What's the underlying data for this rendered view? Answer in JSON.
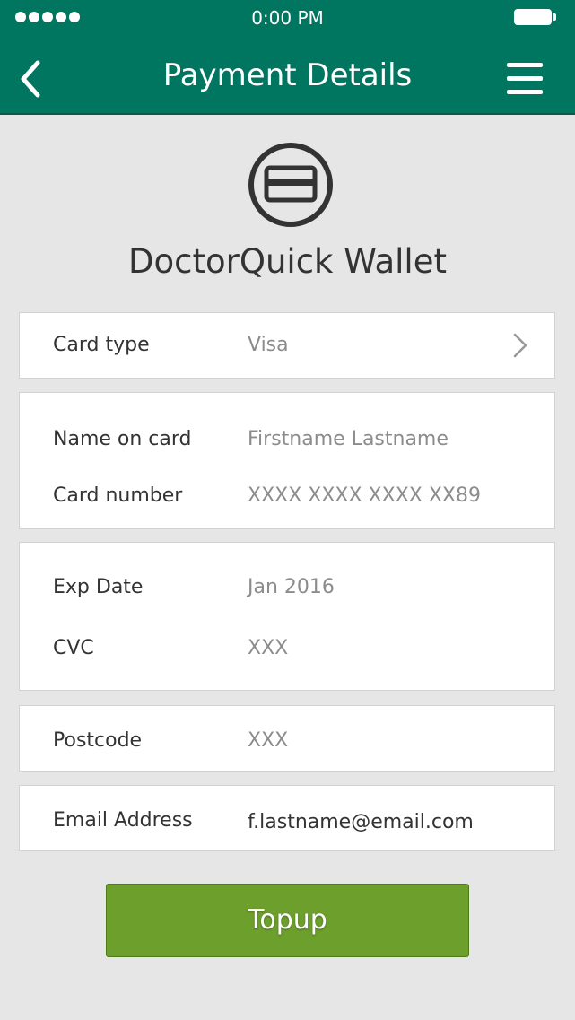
{
  "status_bar": {
    "time": "0:00 PM"
  },
  "nav": {
    "title": "Payment Details"
  },
  "wallet": {
    "title": "DoctorQuick Wallet"
  },
  "card_type": {
    "label": "Card type",
    "value": "Visa"
  },
  "name_on_card": {
    "label": "Name on card",
    "value": "Firstname Lastname"
  },
  "card_number": {
    "label": "Card number",
    "value": "XXXX XXXX XXXX XX89"
  },
  "exp_date": {
    "label": "Exp Date",
    "value": "Jan 2016"
  },
  "cvc": {
    "label": "CVC",
    "value": "XXX"
  },
  "postcode": {
    "label": "Postcode",
    "value": "XXX"
  },
  "email": {
    "label": "Email Address",
    "value": "f.lastname@email.com"
  },
  "actions": {
    "topup_label": "Topup"
  },
  "colors": {
    "header": "#007560",
    "background": "#e6e6e6",
    "button": "#6d9f2d"
  },
  "icons": [
    "signal-icon",
    "battery-icon",
    "back-icon",
    "menu-icon",
    "card-icon",
    "chevron-right-icon"
  ]
}
